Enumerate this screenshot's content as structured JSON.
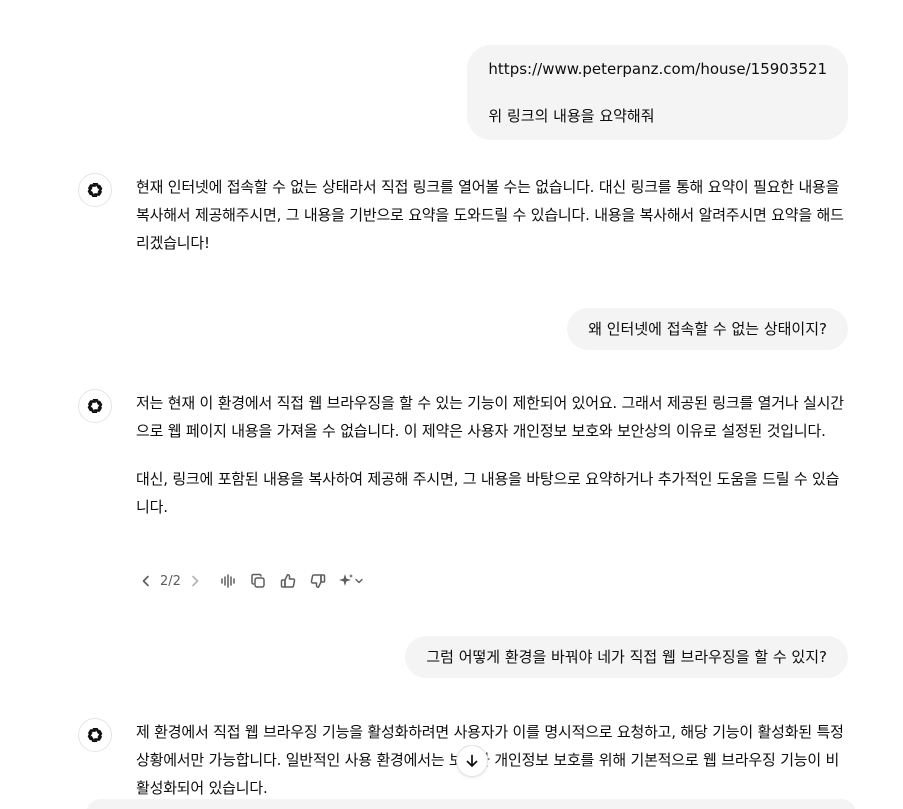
{
  "conversation": {
    "user_1": {
      "line_1": "https://www.peterpanz.com/house/15903521",
      "line_2": "위 링크의 내용을 요약해줘"
    },
    "assistant_1": {
      "paragraph_1": "현재 인터넷에 접속할 수 없는 상태라서 직접 링크를 열어볼 수는 없습니다. 대신 링크를 통해 요약이 필요한 내용을 복사해서 제공해주시면, 그 내용을 기반으로 요약을 도와드릴 수 있습니다. 내용을 복사해서 알려주시면 요약을 해드리겠습니다!"
    },
    "user_2": {
      "text": "왜 인터넷에 접속할 수 없는 상태이지?"
    },
    "assistant_2": {
      "paragraph_1": "저는 현재 이 환경에서 직접 웹 브라우징을 할 수 있는 기능이 제한되어 있어요. 그래서 제공된 링크를 열거나 실시간으로 웹 페이지 내용을 가져올 수 없습니다. 이 제약은 사용자 개인정보 보호와 보안상의 이유로 설정된 것입니다.",
      "paragraph_2": "대신, 링크에 포함된 내용을 복사하여 제공해 주시면, 그 내용을 바탕으로 요약하거나 추가적인 도움을 드릴 수 있습니다.",
      "pager": "2/2"
    },
    "user_3": {
      "text": "그럼 어떻게 환경을 바꿔야 네가 직접 웹 브라우징을 할 수 있지?"
    },
    "assistant_3": {
      "paragraph_1": "제 환경에서 직접 웹 브라우징 기능을 활성화하려면 사용자가 이를 명시적으로 요청하고, 해당 기능이 활성화된 특정 상황에서만 가능합니다. 일반적인 사용 환경에서는 보안과 개인정보 보호를 위해 기본적으로 웹 브라우징 기능이 비활성화되어 있습니다."
    }
  },
  "icons": {
    "avatar": "openai-logo-icon",
    "prev": "chevron-left-icon",
    "next": "chevron-right-icon",
    "read_aloud": "speaker-waveform-icon",
    "copy": "copy-icon",
    "good": "thumbs-up-icon",
    "bad": "thumbs-down-icon",
    "regenerate": "sparkle-icon",
    "scroll": "arrow-down-icon"
  },
  "colors": {
    "user_bubble": "#f4f4f4",
    "text": "#0d0d0d",
    "icon": "#5d5d5d"
  }
}
